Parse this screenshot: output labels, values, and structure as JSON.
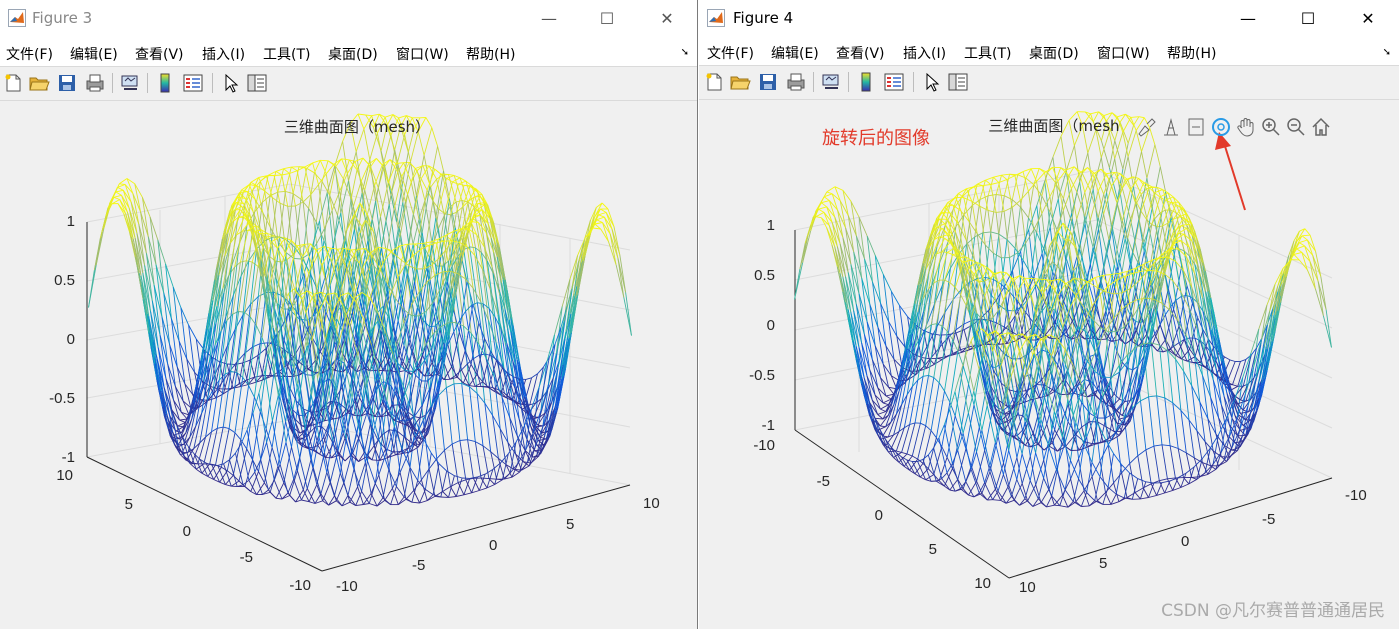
{
  "figure3": {
    "title": "Figure 3",
    "window_buttons": {
      "minimize": "—",
      "maximize": "☐",
      "close": "✕"
    },
    "menu": [
      "文件(F)",
      "编辑(E)",
      "查看(V)",
      "插入(I)",
      "工具(T)",
      "桌面(D)",
      "窗口(W)",
      "帮助(H)"
    ],
    "axes_title": "三维曲面图（mesh）",
    "z_ticks": [
      "1",
      "0.5",
      "0",
      "-0.5",
      "-1"
    ],
    "y_ticks": [
      "10",
      "5",
      "0",
      "-5",
      "-10"
    ],
    "x_ticks": [
      "-10",
      "-5",
      "0",
      "5",
      "10"
    ]
  },
  "figure4": {
    "title": "Figure 4",
    "window_buttons": {
      "minimize": "—",
      "maximize": "☐",
      "close": "✕"
    },
    "menu": [
      "文件(F)",
      "编辑(E)",
      "查看(V)",
      "插入(I)",
      "工具(T)",
      "桌面(D)",
      "窗口(W)",
      "帮助(H)"
    ],
    "axes_title": "三维曲面图（mesh",
    "annotation": "旋转后的图像",
    "z_ticks": [
      "1",
      "0.5",
      "0",
      "-0.5",
      "-1"
    ],
    "y_ticks": [
      "-10",
      "-5",
      "0",
      "5",
      "10"
    ],
    "x_ticks": [
      "10",
      "5",
      "0",
      "-5",
      "-10"
    ],
    "axes_toolbar_icons": [
      "brush-icon",
      "datatip-icon",
      "legend-icon",
      "rotate3d-icon",
      "pan-icon",
      "zoom-in-icon",
      "zoom-out-icon",
      "home-icon"
    ]
  },
  "toolbar_icons": [
    "new-figure-icon",
    "open-file-icon",
    "save-icon",
    "print-icon",
    "link-plot-icon",
    "colorbar-icon",
    "legend-icon",
    "pointer-icon",
    "property-inspector-icon"
  ],
  "watermark": "CSDN @凡尔赛普普通通居民",
  "colors": {
    "arrow": "#e23a2a",
    "annotation": "#e23a2a"
  }
}
